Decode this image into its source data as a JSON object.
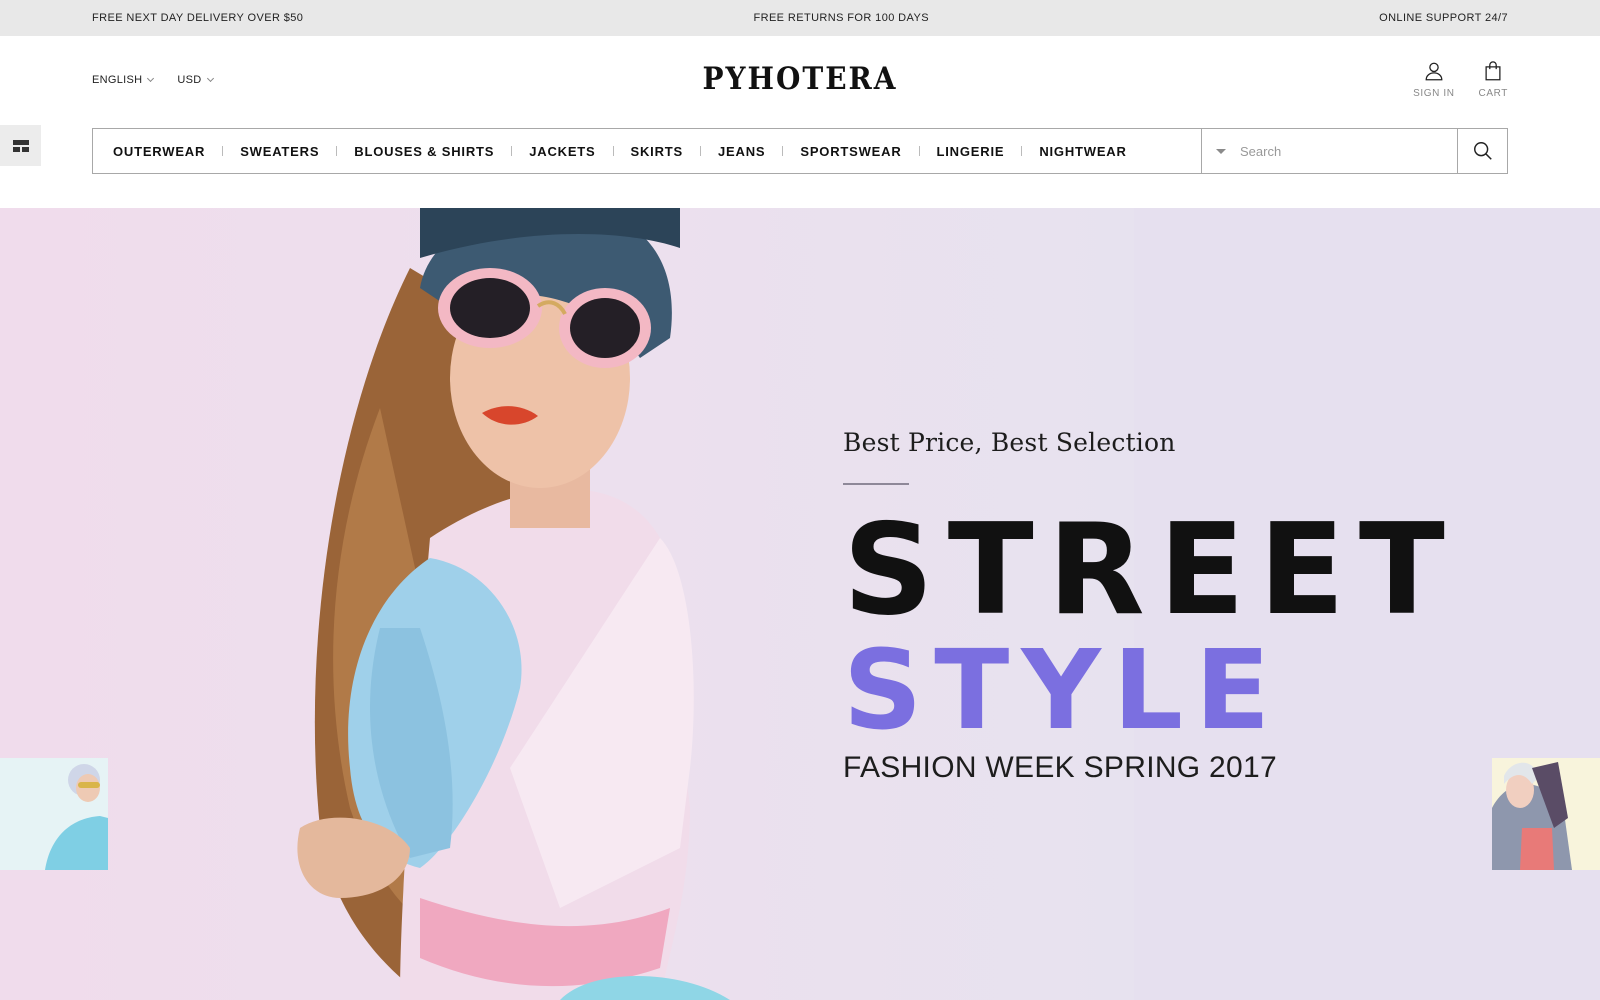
{
  "promo": {
    "left": "FREE NEXT DAY DELIVERY OVER $50",
    "center": "FREE RETURNS FOR 100 DAYS",
    "right": "ONLINE SUPPORT 24/7"
  },
  "header": {
    "language": "ENGLISH",
    "currency": "USD",
    "logo": "PYHOTERA",
    "sign_in": "SIGN IN",
    "cart": "CART"
  },
  "nav": {
    "categories": [
      "OUTERWEAR",
      "SWEATERS",
      "BLOUSES & SHIRTS",
      "JACKETS",
      "SKIRTS",
      "JEANS",
      "SPORTSWEAR",
      "LINGERIE",
      "NIGHTWEAR"
    ],
    "search_placeholder": "Search"
  },
  "hero": {
    "kicker": "Best Price, Best Selection",
    "title_line1": "STREET",
    "title_line2": "STYLE",
    "subtitle": "FASHION WEEK SPRING 2017"
  },
  "colors": {
    "accent": "#7b6fe0",
    "promo_bg": "#e8e8e8",
    "hero_bg": "#ece0ee"
  },
  "icons": {
    "user": "user-icon",
    "cart": "shopping-bag-icon",
    "search": "search-icon",
    "layout": "layout-toggle-icon"
  }
}
